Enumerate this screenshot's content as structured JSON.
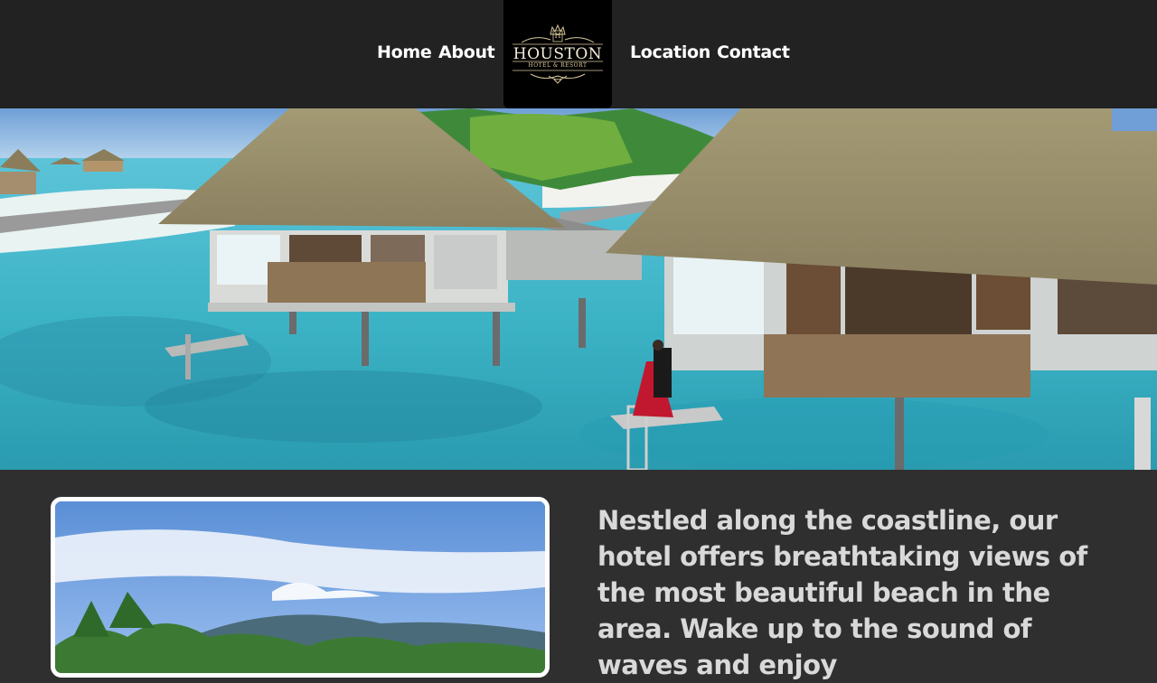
{
  "nav": {
    "home": "Home",
    "about": "About",
    "location": "Location",
    "contact": "Contact"
  },
  "logo": {
    "monogram": "H",
    "name": "HOUSTON",
    "tagline": "HOTEL & RESORT"
  },
  "intro": {
    "text": "Nestled along the coastline, our hotel offers breathtaking views of the most beautiful beach in the area. Wake up to the sound of waves and enjoy"
  },
  "colors": {
    "navbar": "#222222",
    "body": "#2f2f2f",
    "logo_bg": "#000000",
    "text": "#d9d9d9",
    "gold": "#d8c79a"
  }
}
